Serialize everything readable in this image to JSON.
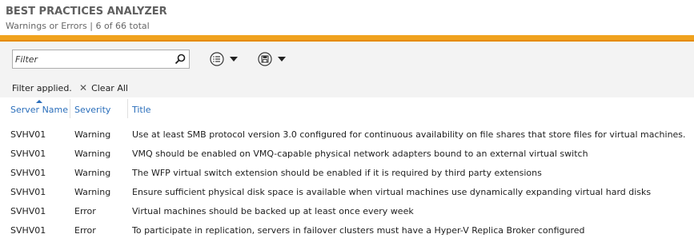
{
  "header": {
    "title": "BEST PRACTICES ANALYZER",
    "subtitle": "Warnings or Errors | 6 of 66 total"
  },
  "toolbar": {
    "filter_placeholder": "Filter",
    "filter_value": "",
    "view_icon": "list-view-icon",
    "save_icon": "save-icon"
  },
  "filter_bar": {
    "status": "Filter applied.",
    "clear_label": "Clear All"
  },
  "columns": [
    "Server Name",
    "Severity",
    "Title"
  ],
  "sort": {
    "column": "Server Name",
    "direction": "ascending"
  },
  "rows": [
    {
      "server": "SVHV01",
      "severity": "Warning",
      "title": "Use at least SMB protocol version 3.0 configured for continuous availability on file shares that store files for virtual machines."
    },
    {
      "server": "SVHV01",
      "severity": "Warning",
      "title": "VMQ should be enabled on VMQ-capable physical network adapters bound to an external virtual switch"
    },
    {
      "server": "SVHV01",
      "severity": "Warning",
      "title": "The WFP virtual switch extension should be enabled if it is required by third party extensions"
    },
    {
      "server": "SVHV01",
      "severity": "Warning",
      "title": "Ensure sufficient physical disk space is available when virtual machines use dynamically expanding virtual hard disks"
    },
    {
      "server": "SVHV01",
      "severity": "Error",
      "title": "Virtual machines should be backed up at least once every week"
    },
    {
      "server": "SVHV01",
      "severity": "Error",
      "title": "To participate in replication, servers in failover clusters must have a Hyper-V Replica Broker configured"
    }
  ],
  "colors": {
    "accent_orange": "#f0a21e",
    "link_blue": "#2a6ebb",
    "panel_bg": "#f3f3f3"
  }
}
